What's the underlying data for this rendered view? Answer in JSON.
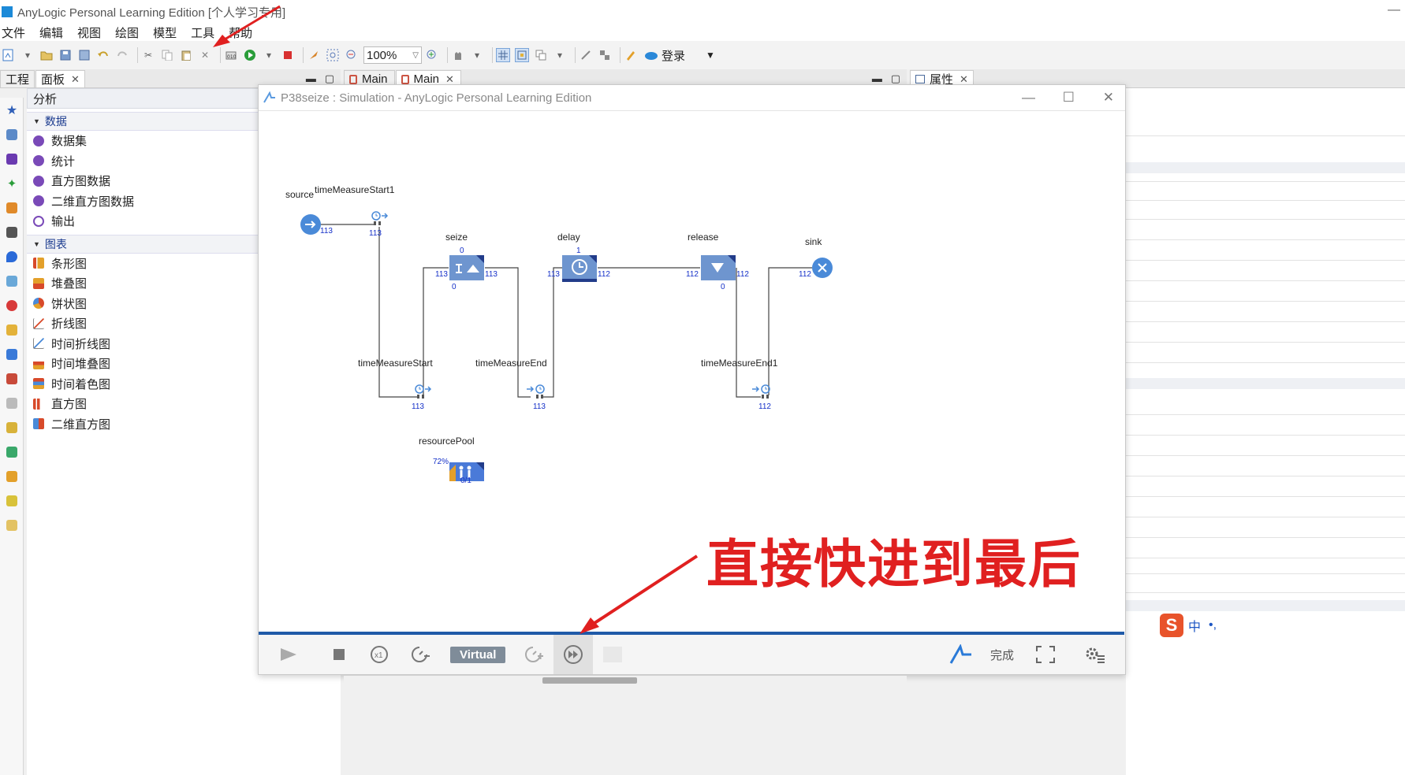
{
  "ide": {
    "title": "AnyLogic Personal Learning Edition [个人学习专用]",
    "menu": [
      "文件",
      "编辑",
      "视图",
      "绘图",
      "模型",
      "工具",
      "帮助"
    ],
    "zoom": "100%",
    "login": "登录"
  },
  "left_panel": {
    "tabs": [
      "工程",
      "面板"
    ],
    "section_title": "分析",
    "data_section": "数据",
    "data_items": [
      "数据集",
      "统计",
      "直方图数据",
      "二维直方图数据",
      "输出"
    ],
    "chart_section": "图表",
    "chart_items": [
      "条形图",
      "堆叠图",
      "饼状图",
      "折线图",
      "时间折线图",
      "时间堆叠图",
      "时间着色图",
      "直方图",
      "二维直方图"
    ]
  },
  "editor_tabs": [
    "Main",
    "Main"
  ],
  "right_tabs": [
    "属性"
  ],
  "simulation": {
    "title": "P38seize : Simulation - AnyLogic Personal Learning Edition",
    "mode": "Virtual",
    "status": "完成",
    "blocks": {
      "source": {
        "name": "source",
        "out": "113"
      },
      "timeMeasureStart1": {
        "name": "timeMeasureStart1",
        "count": "113"
      },
      "seize": {
        "name": "seize",
        "top": "0",
        "in": "113",
        "out": "113",
        "bottom": "0"
      },
      "delay": {
        "name": "delay",
        "top": "1",
        "in": "113",
        "out": "112"
      },
      "release": {
        "name": "release",
        "in": "112",
        "out": "112",
        "bottom": "0"
      },
      "sink": {
        "name": "sink",
        "in": "112"
      },
      "timeMeasureStart": {
        "name": "timeMeasureStart",
        "count": "113"
      },
      "timeMeasureEnd": {
        "name": "timeMeasureEnd",
        "count": "113"
      },
      "timeMeasureEnd1": {
        "name": "timeMeasureEnd1",
        "count": "112"
      },
      "resourcePool": {
        "name": "resourcePool",
        "util": "72%",
        "count": "0/1"
      }
    }
  },
  "annotation": "直接快进到最后",
  "ime": {
    "lang": "中",
    "punct": "•,"
  },
  "colors": {
    "block_blue": "#6e95cf",
    "flow_line": "#444444",
    "count_text": "#1530c8",
    "progress_bar": "#1f5aa8",
    "annotation_red": "#e02020"
  }
}
